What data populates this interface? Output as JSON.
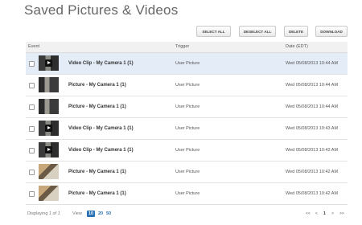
{
  "page": {
    "title": "Saved Pictures & Videos"
  },
  "toolbar": {
    "select_all": "SELECT ALL",
    "deselect_all": "DESELECT ALL",
    "delete": "DELETE",
    "download": "DOWNLOAD"
  },
  "table": {
    "headers": {
      "event": "Event",
      "trigger": "Trigger",
      "date": "Date (EDT)"
    },
    "rows": [
      {
        "type": "video",
        "name": "Video Clip - My Camera 1 (1)",
        "trigger": "User Picture",
        "date": "Wed 05/08/2013 10:44 AM",
        "selected": true,
        "thumb_icon": "video-thumbnail"
      },
      {
        "type": "picture",
        "name": "Picture - My Camera 1 (1)",
        "trigger": "User Picture",
        "date": "Wed 05/08/2013 10:44 AM",
        "selected": false,
        "thumb_icon": "picture-thumbnail"
      },
      {
        "type": "picture",
        "name": "Picture - My Camera 1 (1)",
        "trigger": "User Picture",
        "date": "Wed 05/08/2013 10:44 AM",
        "selected": false,
        "thumb_icon": "picture-thumbnail"
      },
      {
        "type": "video",
        "name": "Video Clip - My Camera 1 (1)",
        "trigger": "User Picture",
        "date": "Wed 05/08/2013 10:43 AM",
        "selected": false,
        "thumb_icon": "video-thumbnail"
      },
      {
        "type": "video",
        "name": "Video Clip - My Camera 1 (1)",
        "trigger": "User Picture",
        "date": "Wed 05/08/2013 10:42 AM",
        "selected": false,
        "thumb_icon": "video-thumbnail"
      },
      {
        "type": "picture",
        "name": "Picture - My Camera 1 (1)",
        "trigger": "User Picture",
        "date": "Wed 05/08/2013 10:42 AM",
        "selected": false,
        "thumb_icon": "picture-thumbnail"
      },
      {
        "type": "picture",
        "name": "Picture - My Camera 1 (1)",
        "trigger": "User Picture",
        "date": "Wed 05/08/2013 10:42 AM",
        "selected": false,
        "thumb_icon": "picture-thumbnail"
      }
    ]
  },
  "footer": {
    "displaying_label": "Displaying",
    "displaying_value": "1 of 1",
    "view_label": "View",
    "view_options": [
      "10",
      "20",
      "50"
    ],
    "view_selected": "10",
    "pager": {
      "first": "<<",
      "prev": "<",
      "current": "1",
      "next": ">",
      "last": ">>"
    }
  },
  "colors": {
    "accent": "#2a72b5",
    "selected_row": "#e3ecf7"
  }
}
